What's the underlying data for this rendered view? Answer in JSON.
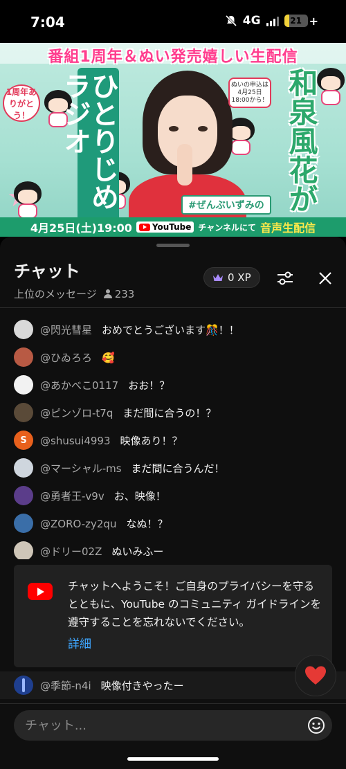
{
  "status_bar": {
    "time": "7:04",
    "network": "4G",
    "battery": "21",
    "battery_level": 0.21,
    "battery_color": "#f1d23a"
  },
  "video": {
    "headline": "番組1周年＆ぬい発売嬉しい生配信",
    "show_title": "ひとりじめラジオ",
    "host_name": "和泉風花が",
    "anniversary_badge": "1周年ありがとう！",
    "doll_note": "ぬいの申込は4月25日18:00から！",
    "hashtag": "#ぜんぶいずみの",
    "date_time": "4月25日(土)19:00",
    "channel_label": "YouTube",
    "suffix": "チャンネルにて",
    "highlight": "音声生配信"
  },
  "chat": {
    "title": "チャット",
    "subtitle": "上位のメッセージ",
    "viewer_count": "233",
    "xp_label": "0 XP",
    "messages": [
      {
        "author": "@閃光彗星",
        "text": "おめでとうございます🎊！！",
        "avatar_color": "#d9d9d9",
        "avatar_icon": "flower-avatar-icon"
      },
      {
        "author": "@ひゐろろ",
        "text": "🥰",
        "avatar_color": "#b85a44",
        "avatar_icon": "portrait-avatar-icon"
      },
      {
        "author": "@あかべこ0117",
        "text": "おお！？",
        "avatar_color": "#f2f2f2",
        "avatar_icon": "cow-avatar-icon"
      },
      {
        "author": "@ピンゾロ-t7q",
        "text": "まだ間に合うの！？",
        "avatar_color": "#5a4a38",
        "avatar_icon": "photo-avatar-icon"
      },
      {
        "author": "@shusui4993",
        "text": "映像あり！？",
        "avatar_color": "#e8601c",
        "avatar_letter": "S"
      },
      {
        "author": "@マーシャル-ms",
        "text": "まだ間に合うんだ！",
        "avatar_color": "#cfd6de",
        "avatar_icon": "cat-avatar-icon"
      },
      {
        "author": "@勇者王-v9v",
        "text": "お、映像！",
        "avatar_color": "#5b3d8a",
        "avatar_icon": "anime-avatar-icon"
      },
      {
        "author": "@ZORO-zy2qu",
        "text": "なぬ！？",
        "avatar_color": "#3a6ea8",
        "avatar_icon": "game-avatar-icon"
      },
      {
        "author": "@ドリー02Z",
        "text": "ぬいみふー",
        "avatar_color": "#cfc6b8",
        "avatar_icon": "doc-avatar-icon"
      }
    ],
    "welcome": {
      "text": "チャットへようこそ！ご自身のプライバシーを守るとともに、YouTube のコミュニティ ガイドラインを遵守することを忘れないでください。",
      "link": "詳細"
    },
    "last_message": {
      "author": "@季節-n4i",
      "text": "映像付きやったー",
      "avatar_color": "#1f3f8f"
    },
    "input_placeholder": "チャット..."
  }
}
